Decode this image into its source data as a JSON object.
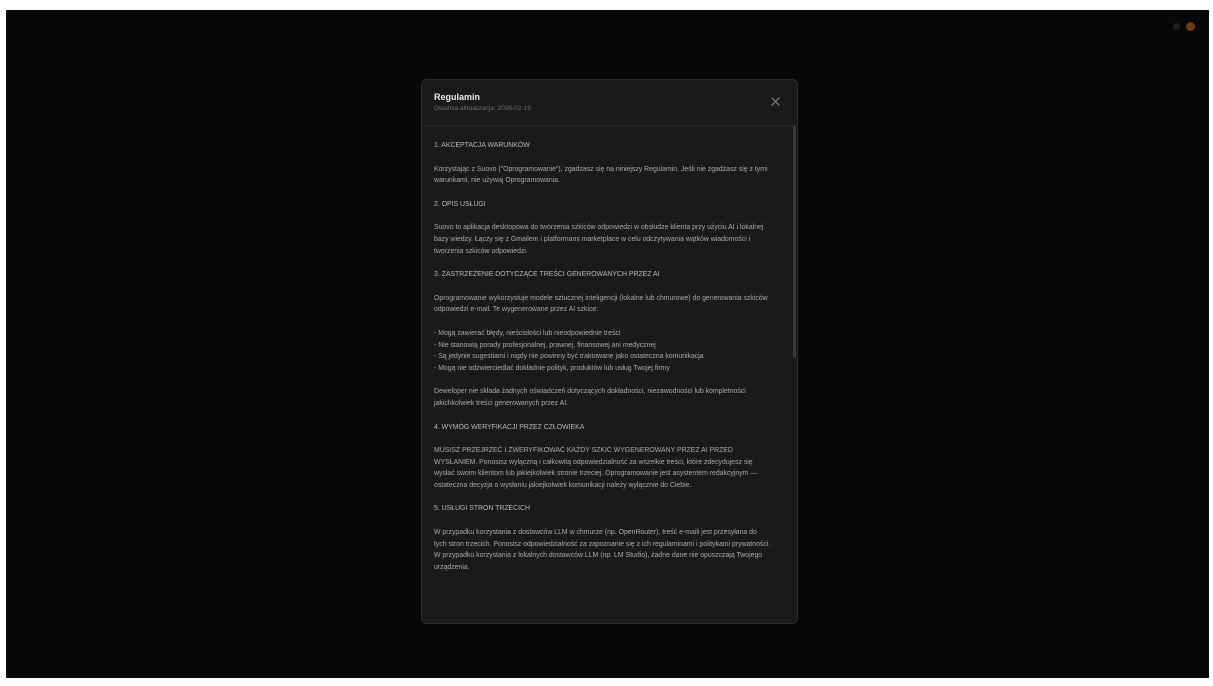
{
  "colors": {
    "backdrop": "#080808",
    "modal_bg": "#1a1a1b",
    "title": "#ececec",
    "body_text": "#a9a9ad",
    "muted": "#6e6e72"
  },
  "modal": {
    "title": "Regulamin",
    "subtitle": "Ostatnia aktualizacja: 2026-02-15",
    "close_icon": "close-icon",
    "scroll_fraction_visible": 0.43
  },
  "sections": [
    {
      "heading": "1. AKCEPTACJA WARUNKÓW",
      "paragraphs": [
        "Korzystając z Suovo (\"Oprogramowanie\"), zgadzasz się na niniejszy Regulamin. Jeśli nie zgadzasz się z tymi warunkami, nie używaj Oprogramowania."
      ]
    },
    {
      "heading": "2. OPIS USŁUGI",
      "paragraphs": [
        "Suovo to aplikacja desktopowa do tworzenia szkiców odpowiedzi w obsłudze klienta przy użyciu AI i lokalnej bazy wiedzy. Łączy się z Gmailem i platformami marketplace w celu odczytywania wątków wiadomości i tworzenia szkiców odpowiedzi."
      ]
    },
    {
      "heading": "3. ZASTRZEŻENIE DOTYCZĄCE TREŚCI GENEROWANYCH PRZEZ AI",
      "paragraphs": [
        "Oprogramowanie wykorzystuje modele sztucznej inteligencji (lokalne lub chmurowe) do generowania szkiców odpowiedzi e-mail. Te wygenerowane przez AI szkice:"
      ],
      "bullets": [
        "- Mogą zawierać błędy, nieścisłości lub nieodpowiednie treści",
        "- Nie stanowią porady profesjonalnej, prawnej, finansowej ani medycznej",
        "- Są jedynie sugestiami i nigdy nie powinny być traktowane jako ostateczna komunikacja",
        "- Mogą nie odzwierciedlać dokładnie polityk, produktów lub usług Twojej firmy"
      ],
      "after": "Deweloper nie składa żadnych oświadczeń dotyczących dokładności, niezawodności lub kompletności jakichkolwiek treści generowanych przez AI."
    },
    {
      "heading": "4. WYMÓG WERYFIKACJI PRZEZ CZŁOWIEKA",
      "paragraphs": [
        "MUSISZ PRZEJRZEĆ I ZWERYFIKOWAĆ KAŻDY SZKIC WYGENEROWANY PRZEZ AI PRZED WYSŁANIEM. Ponosisz wyłączną i całkowitą odpowiedzialność za wszelkie treści, które zdecydujesz się wysłać swoim klientom lub jakiejkolwiek stronie trzeciej. Oprogramowanie jest asystentem redakcyjnym — ostateczna decyzja o wysłaniu jakiejkolwiek komunikacji należy wyłącznie do Ciebie."
      ]
    },
    {
      "heading": "5. USŁUGI STRON TRZECICH",
      "paragraphs": [
        "W przypadku korzystania z dostawców LLM w chmurze (np. OpenRouter), treść e-maili jest przesyłana do tych stron trzecich. Ponosisz odpowiedzialność za zapoznanie się z ich regulaminami i politykami prywatności. W przypadku korzystania z lokalnych dostawców LLM (np. LM Studio), żadne dane nie opuszczają Twojego urządzenia."
      ]
    }
  ]
}
